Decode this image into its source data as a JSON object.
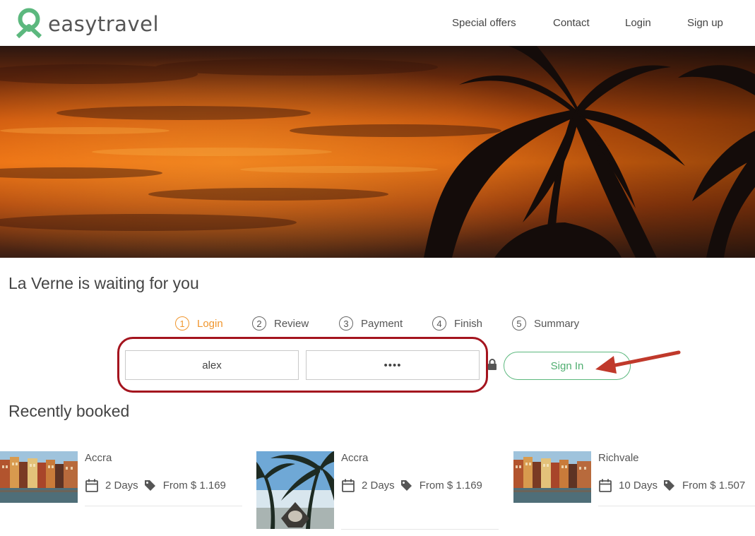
{
  "brand": {
    "name": "easytravel",
    "color": "#5cb87e"
  },
  "nav": {
    "special_offers": "Special offers",
    "contact": "Contact",
    "login": "Login",
    "signup": "Sign up"
  },
  "hero": {
    "image_icon": "sunset-palm-tree-image"
  },
  "destination_title": "La Verne is waiting for you",
  "steps": [
    {
      "num": "1",
      "label": "Login",
      "active": true
    },
    {
      "num": "2",
      "label": "Review",
      "active": false
    },
    {
      "num": "3",
      "label": "Payment",
      "active": false
    },
    {
      "num": "4",
      "label": "Finish",
      "active": false
    },
    {
      "num": "5",
      "label": "Summary",
      "active": false
    }
  ],
  "login_form": {
    "username_value": "alex",
    "password_value": "••••",
    "lock_icon": "lock-icon",
    "signin_label": "Sign In",
    "highlight_color": "#a4141e",
    "arrow_color": "#c0392b"
  },
  "recently_booked": {
    "title": "Recently booked",
    "items": [
      {
        "city": "Accra",
        "days": "2 Days",
        "price": "From $ 1.169",
        "image": "canal-houses-image"
      },
      {
        "city": "Accra",
        "days": "2 Days",
        "price": "From $ 1.169",
        "image": "beach-palm-boat-image"
      },
      {
        "city": "Richvale",
        "days": "10 Days",
        "price": "From $ 1.507",
        "image": "canal-houses-image"
      }
    ]
  },
  "colors": {
    "active_step": "#f0962e",
    "accent_green": "#5cb87e"
  }
}
